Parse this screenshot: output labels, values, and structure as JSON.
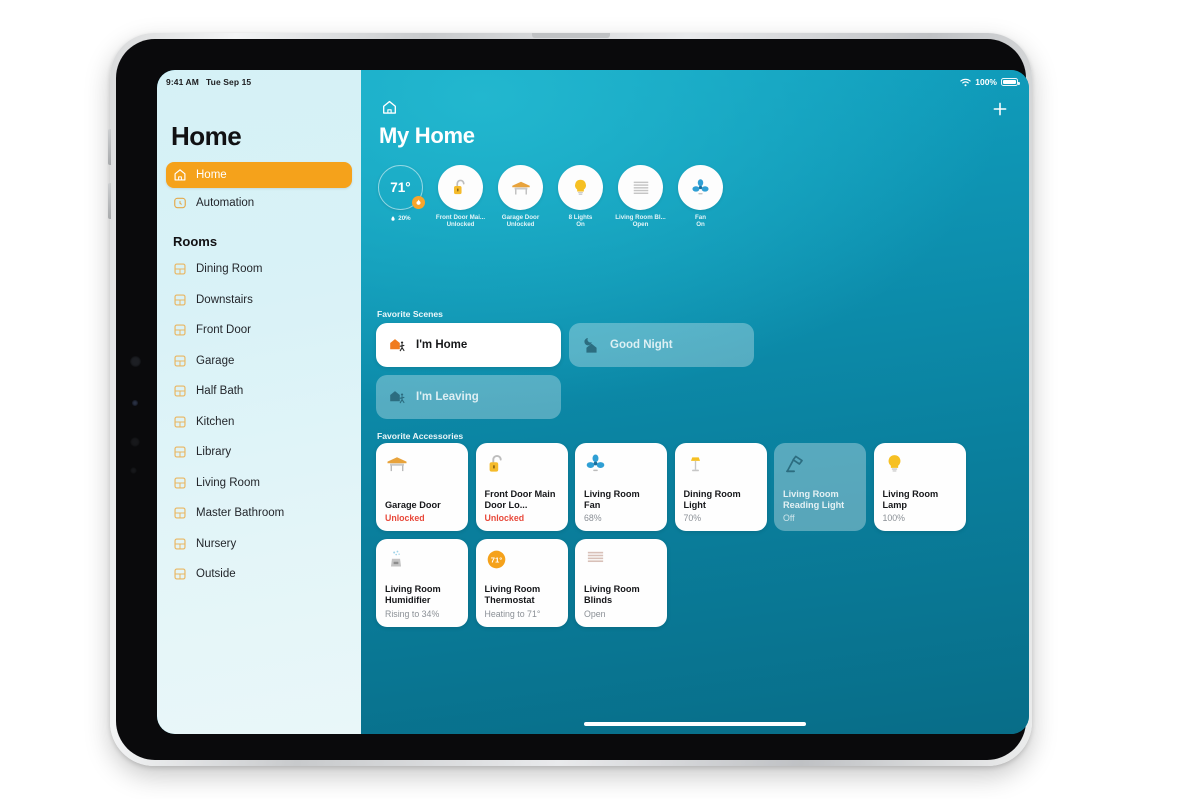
{
  "status_bar": {
    "time": "9:41 AM",
    "date": "Tue Sep 15",
    "wifi_icon": "wifi-icon",
    "battery_percent": "100%",
    "battery_icon": "battery-full-icon"
  },
  "sidebar": {
    "title": "Home",
    "nav": [
      {
        "label": "Home",
        "icon": "house-icon",
        "active": true
      },
      {
        "label": "Automation",
        "icon": "automation-clock-icon",
        "active": false
      }
    ],
    "rooms_header": "Rooms",
    "rooms": [
      {
        "label": "Dining Room",
        "icon": "room-icon"
      },
      {
        "label": "Downstairs",
        "icon": "room-icon"
      },
      {
        "label": "Front Door",
        "icon": "room-icon"
      },
      {
        "label": "Garage",
        "icon": "room-icon"
      },
      {
        "label": "Half Bath",
        "icon": "room-icon"
      },
      {
        "label": "Kitchen",
        "icon": "room-icon"
      },
      {
        "label": "Library",
        "icon": "room-icon"
      },
      {
        "label": "Living Room",
        "icon": "room-icon"
      },
      {
        "label": "Master Bathroom",
        "icon": "room-icon"
      },
      {
        "label": "Nursery",
        "icon": "room-icon"
      },
      {
        "label": "Outside",
        "icon": "room-icon"
      }
    ]
  },
  "main": {
    "home_icon": "house-outline-icon",
    "add_icon": "plus-icon",
    "title": "My Home",
    "status_circles": [
      {
        "type": "temperature",
        "value": "71°",
        "humidity": "20%",
        "humidity_icon": "droplet-icon",
        "badge_icon": "flame-icon"
      },
      {
        "type": "accessory",
        "icon": "unlocked-padlock-icon",
        "line1": "Front Door Mai...",
        "line2": "Unlocked"
      },
      {
        "type": "accessory",
        "icon": "garage-door-icon",
        "line1": "Garage Door",
        "line2": "Unlocked"
      },
      {
        "type": "accessory",
        "icon": "lightbulb-icon",
        "line1": "8 Lights",
        "line2": "On"
      },
      {
        "type": "accessory",
        "icon": "blinds-icon",
        "line1": "Living Room Bl...",
        "line2": "Open"
      },
      {
        "type": "accessory",
        "icon": "fan-icon",
        "line1": "Fan",
        "line2": "On"
      }
    ],
    "scenes_header": "Favorite Scenes",
    "scenes": [
      {
        "label": "I'm Home",
        "icon": "house-arrive-icon",
        "state": "on"
      },
      {
        "label": "Good Night",
        "icon": "moon-house-icon",
        "state": "off"
      },
      {
        "label": "I'm Leaving",
        "icon": "house-leave-icon",
        "state": "off"
      }
    ],
    "accessories_header": "Favorite Accessories",
    "accessories": [
      {
        "name": "Garage Door",
        "state": "Unlocked",
        "state_kind": "alert",
        "icon": "garage-door-icon",
        "power": "on"
      },
      {
        "name": "Front Door Main Door Lo...",
        "state": "Unlocked",
        "state_kind": "alert",
        "icon": "unlocked-padlock-icon",
        "power": "on"
      },
      {
        "name": "Living Room Fan",
        "state": "68%",
        "state_kind": "normal",
        "icon": "fan-icon",
        "power": "on"
      },
      {
        "name": "Dining Room Light",
        "state": "70%",
        "state_kind": "normal",
        "icon": "floor-lamp-icon",
        "power": "on"
      },
      {
        "name": "Living Room Reading Light",
        "state": "Off",
        "state_kind": "normal",
        "icon": "desk-lamp-icon",
        "power": "off"
      },
      {
        "name": "Living Room Lamp",
        "state": "100%",
        "state_kind": "normal",
        "icon": "lightbulb-icon",
        "power": "on"
      },
      {
        "name": "Living Room Humidifier",
        "state": "Rising to 34%",
        "state_kind": "normal",
        "icon": "humidifier-icon",
        "power": "on"
      },
      {
        "name": "Living Room Thermostat",
        "state": "Heating to 71°",
        "state_kind": "normal",
        "icon": "thermostat-icon",
        "power": "on"
      },
      {
        "name": "Living Room Blinds",
        "state": "Open",
        "state_kind": "normal",
        "icon": "blinds-icon",
        "power": "on"
      }
    ]
  },
  "colors": {
    "accent_orange": "#f5a21b",
    "alert_red": "#e8493b",
    "background_teal": "#0d8fae",
    "sidebar_blue": "#dbf2f7"
  }
}
